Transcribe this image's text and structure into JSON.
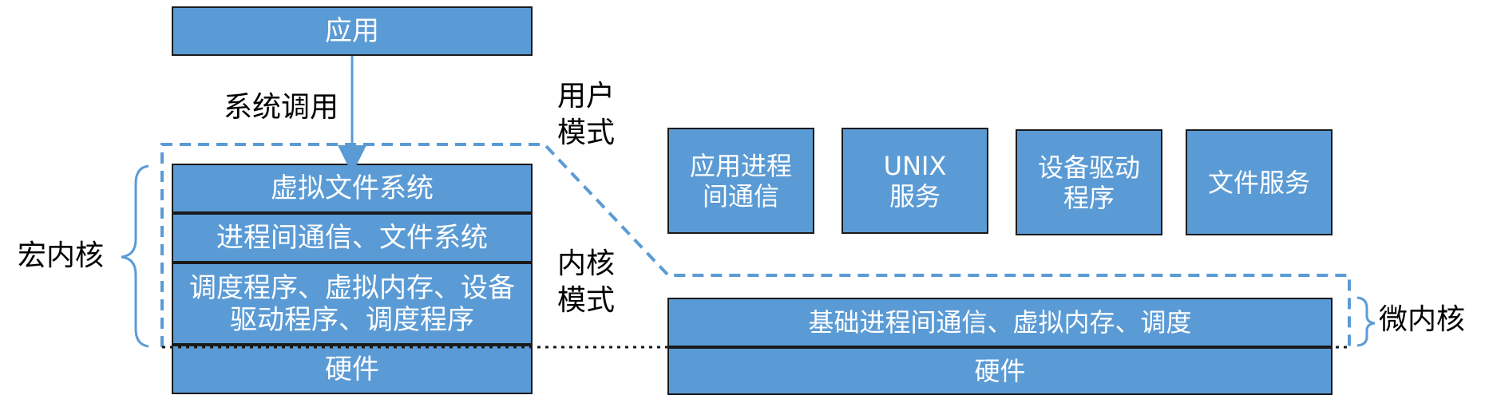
{
  "diagram": {
    "monolithic": {
      "app": "应用",
      "syscall_label": "系统调用",
      "layers": [
        "虚拟文件系统",
        "进程间通信、文件系统",
        "调度程序、虚拟内存、设备驱动程序、调度程序"
      ],
      "hardware": "硬件",
      "brace_label": "宏内核"
    },
    "modes": {
      "user_line1": "用户",
      "user_line2": "模式",
      "kernel_line1": "内核",
      "kernel_line2": "模式"
    },
    "microkernel": {
      "servers": [
        {
          "line1": "应用进程",
          "line2": "间通信"
        },
        {
          "line1": "UNIX",
          "line2": "服务"
        },
        {
          "line1": "设备驱动",
          "line2": "程序"
        },
        {
          "line1": "文件服务",
          "line2": ""
        }
      ],
      "core": "基础进程间通信、虚拟内存、调度",
      "hardware": "硬件",
      "brace_label": "微内核"
    },
    "colors": {
      "box_fill": "#5b9bd5",
      "box_border": "#1a1a1a",
      "dashed_boundary": "#5b9bd5",
      "text_on_box": "#ffffff"
    }
  }
}
